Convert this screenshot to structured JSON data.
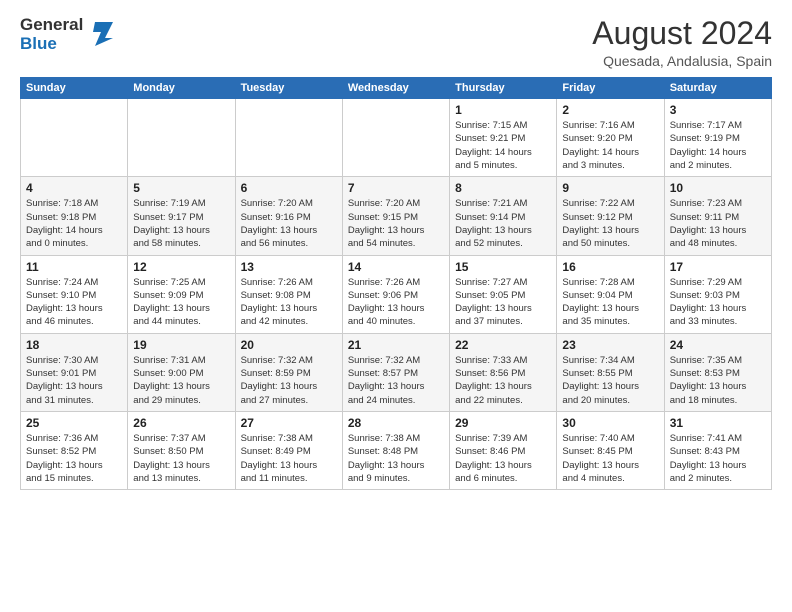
{
  "logo": {
    "general": "General",
    "blue": "Blue"
  },
  "header": {
    "month": "August 2024",
    "location": "Quesada, Andalusia, Spain"
  },
  "weekdays": [
    "Sunday",
    "Monday",
    "Tuesday",
    "Wednesday",
    "Thursday",
    "Friday",
    "Saturday"
  ],
  "weeks": [
    [
      {
        "day": "",
        "info": ""
      },
      {
        "day": "",
        "info": ""
      },
      {
        "day": "",
        "info": ""
      },
      {
        "day": "",
        "info": ""
      },
      {
        "day": "1",
        "info": "Sunrise: 7:15 AM\nSunset: 9:21 PM\nDaylight: 14 hours\nand 5 minutes."
      },
      {
        "day": "2",
        "info": "Sunrise: 7:16 AM\nSunset: 9:20 PM\nDaylight: 14 hours\nand 3 minutes."
      },
      {
        "day": "3",
        "info": "Sunrise: 7:17 AM\nSunset: 9:19 PM\nDaylight: 14 hours\nand 2 minutes."
      }
    ],
    [
      {
        "day": "4",
        "info": "Sunrise: 7:18 AM\nSunset: 9:18 PM\nDaylight: 14 hours\nand 0 minutes."
      },
      {
        "day": "5",
        "info": "Sunrise: 7:19 AM\nSunset: 9:17 PM\nDaylight: 13 hours\nand 58 minutes."
      },
      {
        "day": "6",
        "info": "Sunrise: 7:20 AM\nSunset: 9:16 PM\nDaylight: 13 hours\nand 56 minutes."
      },
      {
        "day": "7",
        "info": "Sunrise: 7:20 AM\nSunset: 9:15 PM\nDaylight: 13 hours\nand 54 minutes."
      },
      {
        "day": "8",
        "info": "Sunrise: 7:21 AM\nSunset: 9:14 PM\nDaylight: 13 hours\nand 52 minutes."
      },
      {
        "day": "9",
        "info": "Sunrise: 7:22 AM\nSunset: 9:12 PM\nDaylight: 13 hours\nand 50 minutes."
      },
      {
        "day": "10",
        "info": "Sunrise: 7:23 AM\nSunset: 9:11 PM\nDaylight: 13 hours\nand 48 minutes."
      }
    ],
    [
      {
        "day": "11",
        "info": "Sunrise: 7:24 AM\nSunset: 9:10 PM\nDaylight: 13 hours\nand 46 minutes."
      },
      {
        "day": "12",
        "info": "Sunrise: 7:25 AM\nSunset: 9:09 PM\nDaylight: 13 hours\nand 44 minutes."
      },
      {
        "day": "13",
        "info": "Sunrise: 7:26 AM\nSunset: 9:08 PM\nDaylight: 13 hours\nand 42 minutes."
      },
      {
        "day": "14",
        "info": "Sunrise: 7:26 AM\nSunset: 9:06 PM\nDaylight: 13 hours\nand 40 minutes."
      },
      {
        "day": "15",
        "info": "Sunrise: 7:27 AM\nSunset: 9:05 PM\nDaylight: 13 hours\nand 37 minutes."
      },
      {
        "day": "16",
        "info": "Sunrise: 7:28 AM\nSunset: 9:04 PM\nDaylight: 13 hours\nand 35 minutes."
      },
      {
        "day": "17",
        "info": "Sunrise: 7:29 AM\nSunset: 9:03 PM\nDaylight: 13 hours\nand 33 minutes."
      }
    ],
    [
      {
        "day": "18",
        "info": "Sunrise: 7:30 AM\nSunset: 9:01 PM\nDaylight: 13 hours\nand 31 minutes."
      },
      {
        "day": "19",
        "info": "Sunrise: 7:31 AM\nSunset: 9:00 PM\nDaylight: 13 hours\nand 29 minutes."
      },
      {
        "day": "20",
        "info": "Sunrise: 7:32 AM\nSunset: 8:59 PM\nDaylight: 13 hours\nand 27 minutes."
      },
      {
        "day": "21",
        "info": "Sunrise: 7:32 AM\nSunset: 8:57 PM\nDaylight: 13 hours\nand 24 minutes."
      },
      {
        "day": "22",
        "info": "Sunrise: 7:33 AM\nSunset: 8:56 PM\nDaylight: 13 hours\nand 22 minutes."
      },
      {
        "day": "23",
        "info": "Sunrise: 7:34 AM\nSunset: 8:55 PM\nDaylight: 13 hours\nand 20 minutes."
      },
      {
        "day": "24",
        "info": "Sunrise: 7:35 AM\nSunset: 8:53 PM\nDaylight: 13 hours\nand 18 minutes."
      }
    ],
    [
      {
        "day": "25",
        "info": "Sunrise: 7:36 AM\nSunset: 8:52 PM\nDaylight: 13 hours\nand 15 minutes."
      },
      {
        "day": "26",
        "info": "Sunrise: 7:37 AM\nSunset: 8:50 PM\nDaylight: 13 hours\nand 13 minutes."
      },
      {
        "day": "27",
        "info": "Sunrise: 7:38 AM\nSunset: 8:49 PM\nDaylight: 13 hours\nand 11 minutes."
      },
      {
        "day": "28",
        "info": "Sunrise: 7:38 AM\nSunset: 8:48 PM\nDaylight: 13 hours\nand 9 minutes."
      },
      {
        "day": "29",
        "info": "Sunrise: 7:39 AM\nSunset: 8:46 PM\nDaylight: 13 hours\nand 6 minutes."
      },
      {
        "day": "30",
        "info": "Sunrise: 7:40 AM\nSunset: 8:45 PM\nDaylight: 13 hours\nand 4 minutes."
      },
      {
        "day": "31",
        "info": "Sunrise: 7:41 AM\nSunset: 8:43 PM\nDaylight: 13 hours\nand 2 minutes."
      }
    ]
  ]
}
